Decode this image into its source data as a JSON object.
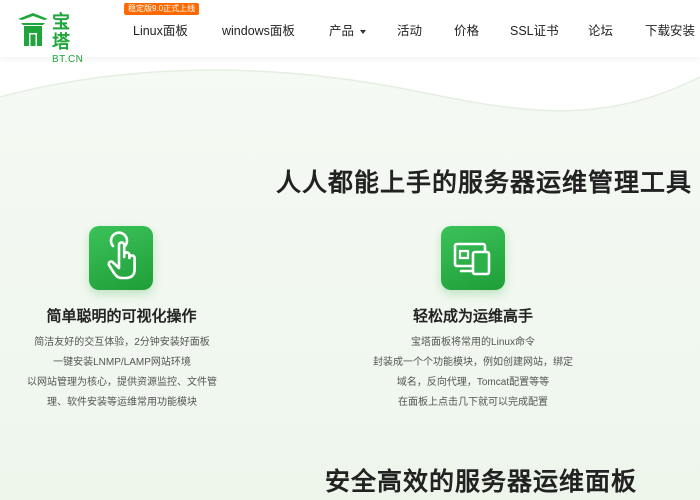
{
  "header": {
    "logo": {
      "name_cn": "宝塔",
      "name_en": "BT.CN"
    },
    "promo_badge": "稳定版9.0正式上线",
    "nav": [
      {
        "label": "Linux面板"
      },
      {
        "label": "windows面板"
      },
      {
        "label": "产品",
        "has_dropdown": true
      },
      {
        "label": "活动"
      },
      {
        "label": "价格"
      },
      {
        "label": "SSL证书"
      },
      {
        "label": "论坛"
      },
      {
        "label": "下载安装"
      }
    ]
  },
  "main": {
    "section1_title": "人人都能上手的服务器运维管理工具",
    "features": [
      {
        "icon": "touch-hand-icon",
        "title": "简单聪明的可视化操作",
        "lines": [
          "简洁友好的交互体验，2分钟安装好面板",
          "一键安装LNMP/LAMP网站环境",
          "以网站管理为核心，提供资源监控、文件管",
          "理、软件安装等运维常用功能模块"
        ]
      },
      {
        "icon": "devices-icon",
        "title": "轻松成为运维高手",
        "lines": [
          "宝塔面板将常用的Linux命令",
          "封装成一个个功能模块，例如创建网站，绑定",
          "域名，反向代理，Tomcat配置等等",
          "在面板上点击几下就可以完成配置"
        ]
      }
    ],
    "section2_title": "安全高效的服务器运维面板"
  },
  "colors": {
    "brand": "#20a53a",
    "badge": "#ff6a00"
  }
}
